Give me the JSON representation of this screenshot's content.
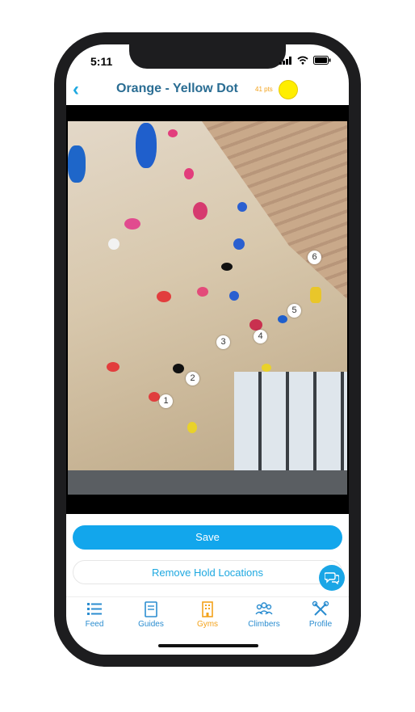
{
  "status_bar": {
    "time": "5:11"
  },
  "header": {
    "title": "Orange - Yellow Dot",
    "points": "41 pts",
    "dot_color": "#ffee00"
  },
  "markers": [
    "1",
    "2",
    "3",
    "4",
    "5",
    "6"
  ],
  "actions": {
    "save_label": "Save",
    "remove_label": "Remove Hold Locations"
  },
  "tabs": [
    {
      "label": "Feed",
      "icon": "list-icon",
      "active": false
    },
    {
      "label": "Guides",
      "icon": "book-icon",
      "active": false
    },
    {
      "label": "Gyms",
      "icon": "building-icon",
      "active": true
    },
    {
      "label": "Climbers",
      "icon": "people-icon",
      "active": false
    },
    {
      "label": "Profile",
      "icon": "tools-icon",
      "active": false
    }
  ],
  "colors": {
    "accent": "#12a6ec",
    "active_tab": "#f3a21a",
    "title": "#2a6d93"
  }
}
